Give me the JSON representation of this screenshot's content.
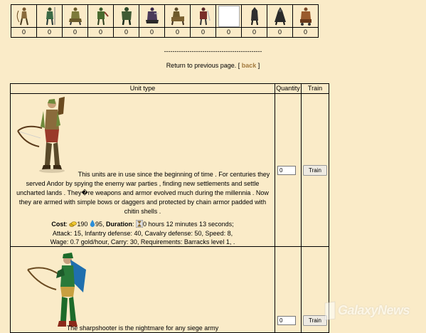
{
  "units_strip": {
    "icons": [
      {
        "name": "archer-unit-icon",
        "color": "#8a6b3c"
      },
      {
        "name": "spearman-unit-icon",
        "color": "#3c6a45"
      },
      {
        "name": "rider-unit-icon",
        "color": "#7d7a3a"
      },
      {
        "name": "ranger-unit-icon",
        "color": "#4a6b2f"
      },
      {
        "name": "warrior-unit-icon",
        "color": "#3f5a33"
      },
      {
        "name": "knight-unit-icon",
        "color": "#4b3b5a"
      },
      {
        "name": "cavalry-unit-icon",
        "color": "#6e5a2a"
      },
      {
        "name": "swordsman-unit-icon",
        "color": "#7a2f28"
      },
      {
        "name": "empty-slot-icon",
        "color": "#ffffff"
      },
      {
        "name": "hooded-unit-icon",
        "color": "#2f2f2f"
      },
      {
        "name": "mage-unit-icon",
        "color": "#2a2a2a"
      },
      {
        "name": "siege-unit-icon",
        "color": "#9a5b2c"
      }
    ],
    "counts": [
      "0",
      "0",
      "0",
      "0",
      "0",
      "0",
      "0",
      "0",
      "0",
      "0",
      "0",
      "0"
    ]
  },
  "divider": "----------------------------------------------",
  "return_text": "Return to previous page. [",
  "back_label": "back",
  "return_close": "]",
  "table": {
    "headers": {
      "type": "Unit type",
      "quantity": "Quantity",
      "train": "Train"
    },
    "rows": [
      {
        "description": "This units are in use since the beginning of time . For centuries they served Andor by spying the enemy war parties , finding new settlements and settle uncharted lands . They�re weapons and armor evolved much during the millennia . Now they are armed with simple bows or daggers and protected by chain armor padded with chitin shells .",
        "cost_label": "Cost",
        "gold": "190",
        "water": "95",
        "duration_label": "Duration",
        "duration": "0 hours 12 minutes 13 seconds;",
        "stats": "Attack: 15, Infantry defense: 40, Cavalry defense: 50, Speed: 8,",
        "wage": "Wage: 0.7 gold/hour, Carry: 30, Requirements: Barracks level 1, .",
        "quantity_value": "0",
        "train_label": "Train"
      },
      {
        "description": "The sharpshooter is the nightmare for any siege army",
        "quantity_value": "0",
        "train_label": "Train"
      }
    ]
  },
  "watermark": "GalaxyNews"
}
